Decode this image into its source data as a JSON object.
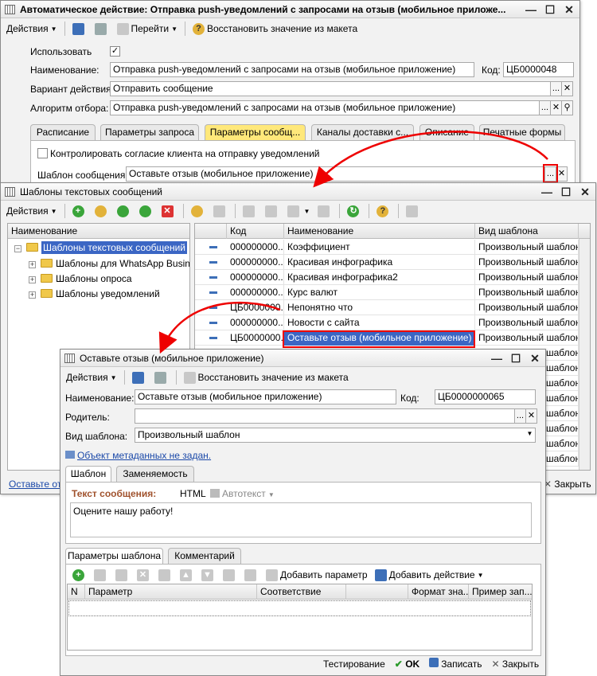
{
  "win1": {
    "title": "Автоматическое действие: Отправка push-уведомлений с запросами на отзыв (мобильное приложе...",
    "toolbar": {
      "actions": "Действия",
      "goto": "Перейти",
      "restore": "Восстановить значение из макета"
    },
    "use_label": "Использовать",
    "name_label": "Наименование:",
    "name_value": "Отправка push-уведомлений с запросами на отзыв (мобильное приложение)",
    "code_label": "Код:",
    "code_value": "ЦБ0000048",
    "variant_label": "Вариант действия:",
    "variant_value": "Отправить сообщение",
    "algo_label": "Алгоритм отбора:",
    "algo_value": "Отправка push-уведомлений с запросами на отзыв (мобильное приложение)",
    "tabs": [
      "Расписание",
      "Параметры запроса",
      "Параметры сообщ...",
      "Каналы доставки с...",
      "Описание",
      "Печатные формы"
    ],
    "consent_label": "Контролировать согласие клиента на отправку уведомлений",
    "template_label": "Шаблон сообщения:",
    "template_value": "Оставьте отзыв (мобильное приложение)",
    "status_text": "Оставьте отз",
    "close_label": "Закрыть"
  },
  "win2": {
    "title": "Шаблоны текстовых сообщений",
    "toolbar": {
      "actions": "Действия"
    },
    "tree_header": "Наименование",
    "tree": [
      "Шаблоны текстовых сообщений",
      "Шаблоны для WhatsApp Business",
      "Шаблоны опроса",
      "Шаблоны уведомлений"
    ],
    "columns": [
      "Код",
      "Наименование",
      "Вид шаблона"
    ],
    "rows": [
      {
        "code": "000000000...",
        "name": "Коэффициент",
        "kind": "Произвольный шаблон"
      },
      {
        "code": "000000000...",
        "name": "Красивая инфографика",
        "kind": "Произвольный шаблон"
      },
      {
        "code": "000000000...",
        "name": "Красивая инфографика2",
        "kind": "Произвольный шаблон"
      },
      {
        "code": "000000000...",
        "name": "Курс валют",
        "kind": "Произвольный шаблон"
      },
      {
        "code": "ЦБ0000000...",
        "name": "Непонятно что",
        "kind": "Произвольный шаблон"
      },
      {
        "code": "000000000...",
        "name": "Новости с сайта",
        "kind": "Произвольный шаблон"
      },
      {
        "code": "ЦБ0000000...",
        "name": "Оставьте отзыв (мобильное приложение)",
        "kind": "Произвольный шаблон"
      }
    ],
    "extra_kind": [
      "шаблон",
      "шаблон",
      "шаблон",
      "шаблон",
      "шаблон",
      "шаблон",
      "шаблон",
      "шаблон"
    ]
  },
  "win3": {
    "title": "Оставьте отзыв (мобильное приложение)",
    "toolbar": {
      "actions": "Действия",
      "restore": "Восстановить значение из макета"
    },
    "name_label": "Наименование:",
    "name_value": "Оставьте отзыв (мобильное приложение)",
    "code_label": "Код:",
    "code_value": "ЦБ0000000065",
    "parent_label": "Родитель:",
    "parent_value": "",
    "kind_label": "Вид шаблона:",
    "kind_value": "Произвольный шаблон",
    "metadata_link": "Объект метаданных не задан.",
    "tabs": [
      "Шаблон",
      "Заменяемость"
    ],
    "text_label": "Текст сообщения:",
    "html_label": "HTML",
    "autotext_label": "Автотекст",
    "message_text": "Оцените нашу работу!",
    "bottom_tabs": [
      "Параметры шаблона",
      "Комментарий"
    ],
    "add_param": "Добавить параметр",
    "add_action": "Добавить действие",
    "columns": [
      "N",
      "Параметр",
      "Соответствие",
      "",
      "Формат зна...",
      "Пример зап..."
    ],
    "test_label": "Тестирование",
    "ok_label": "OK",
    "save_label": "Записать",
    "close_label": "Закрыть"
  }
}
